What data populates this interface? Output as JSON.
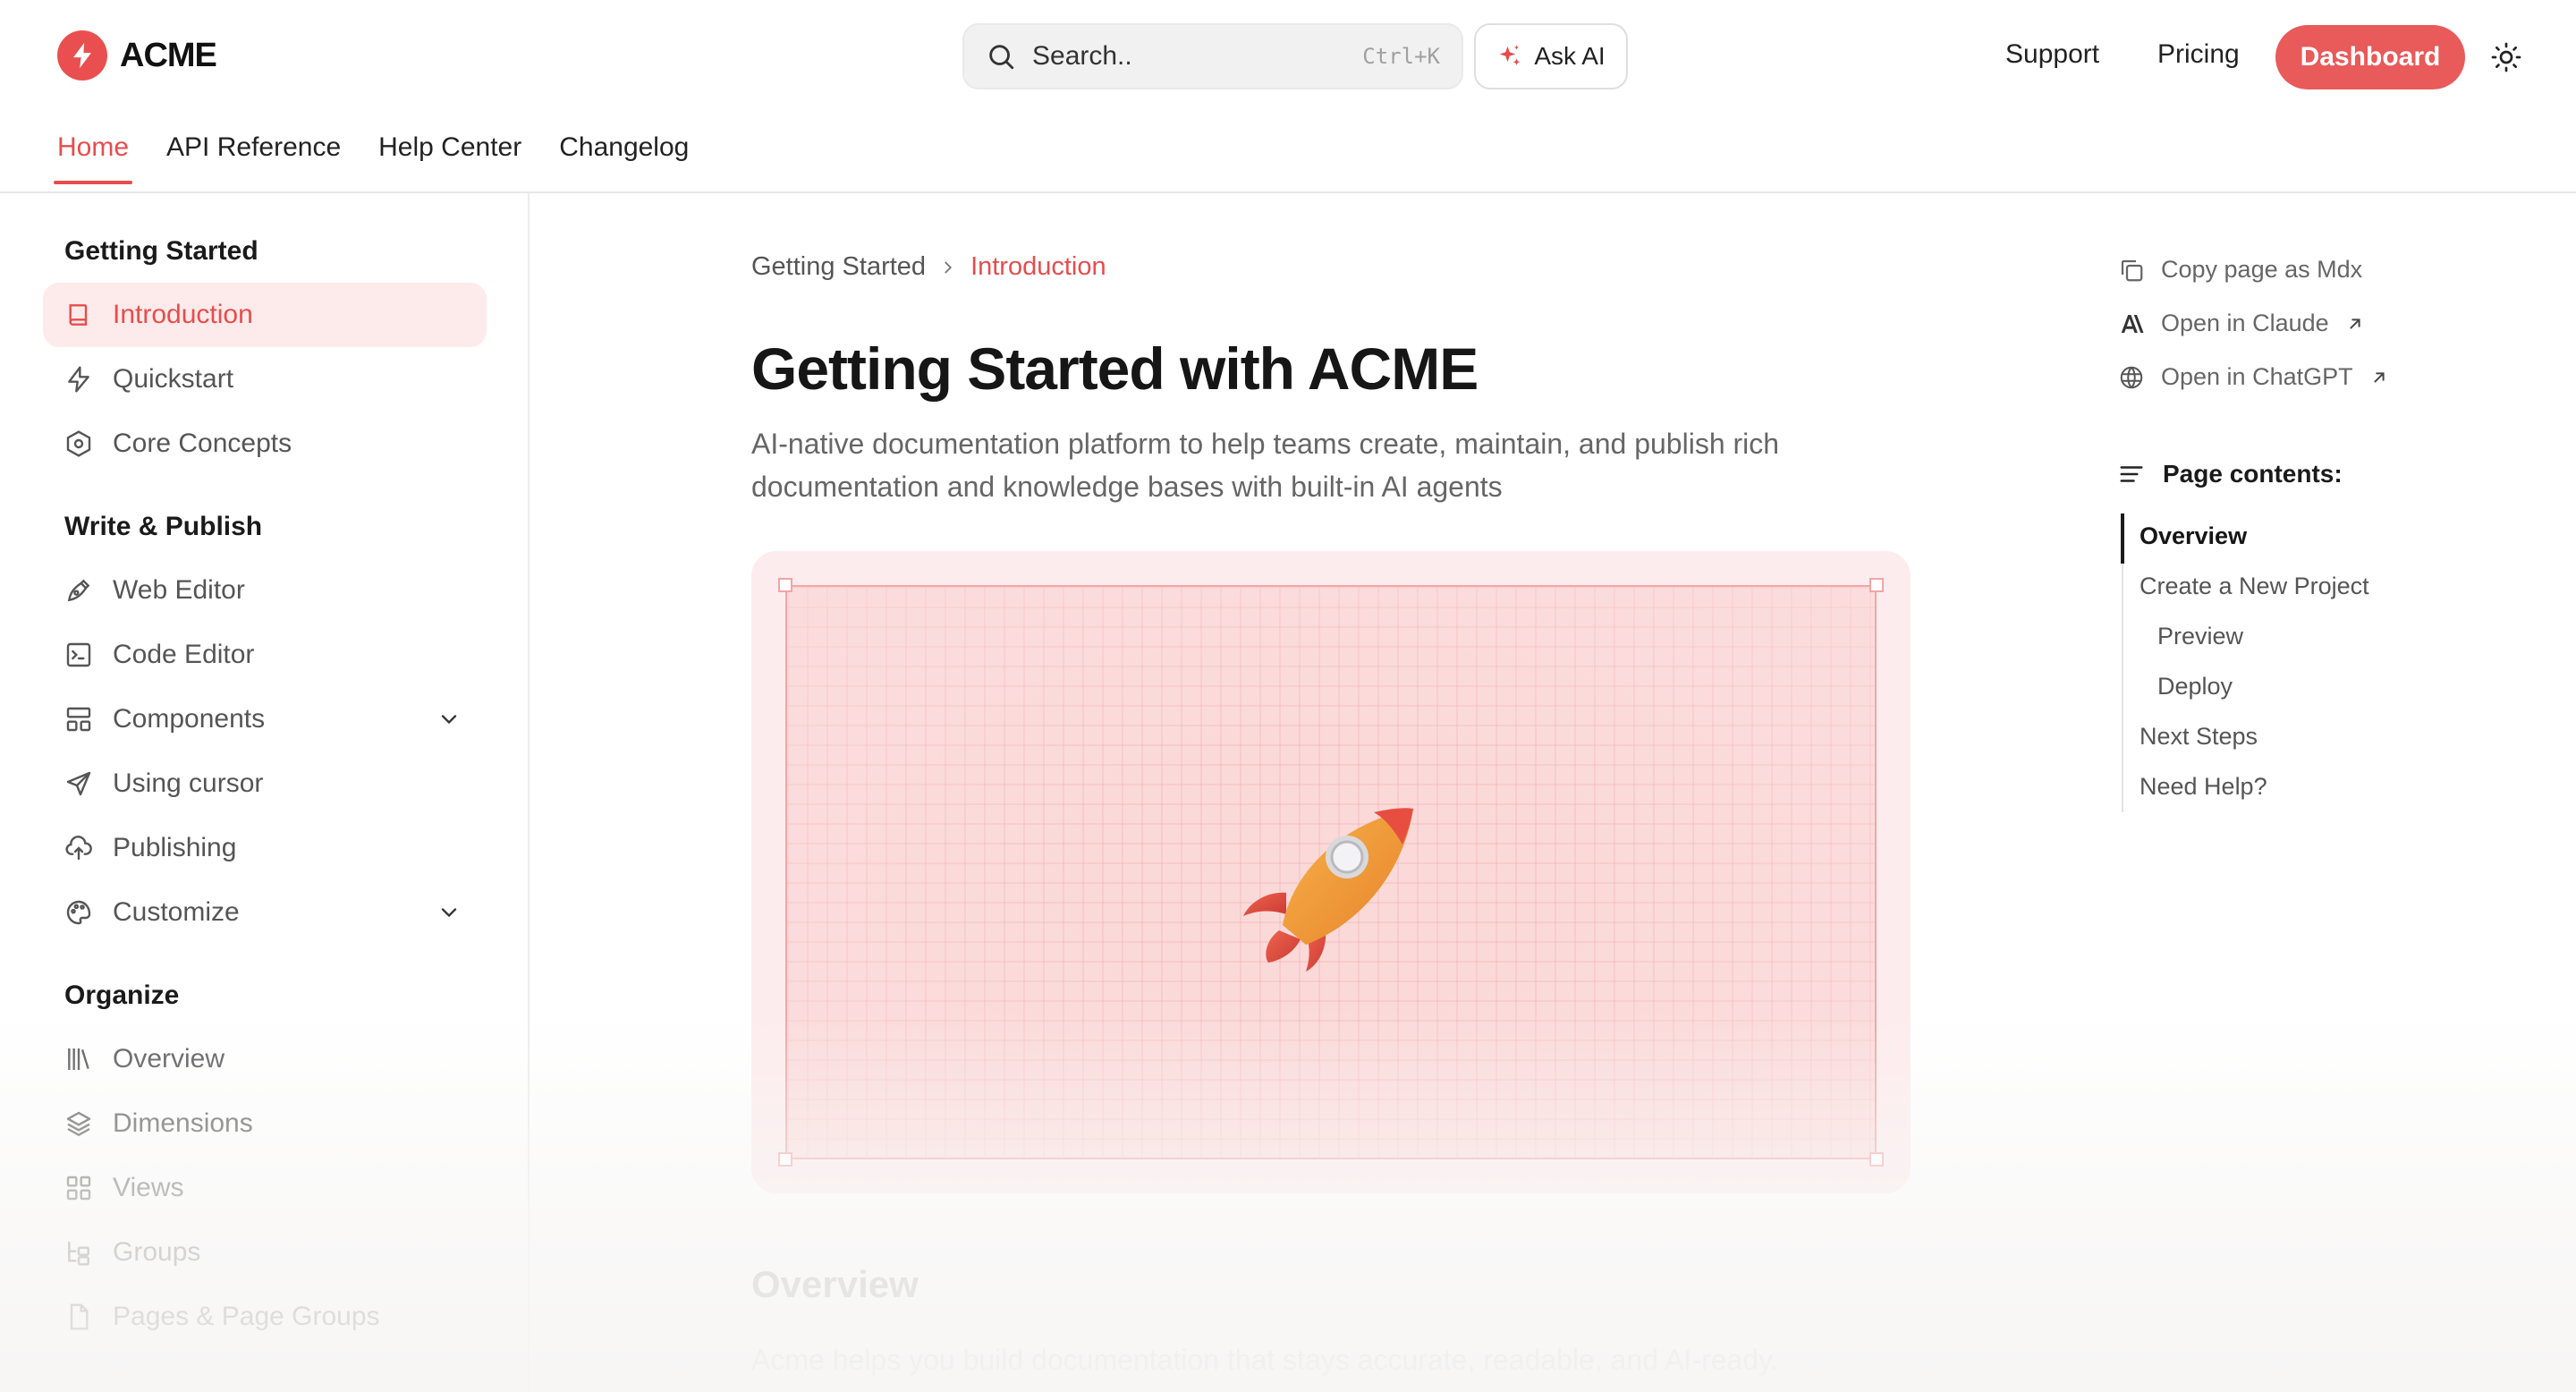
{
  "header": {
    "brand": "ACME",
    "search_placeholder": "Search..",
    "search_shortcut": "Ctrl+K",
    "ask_ai": "Ask AI",
    "support": "Support",
    "pricing": "Pricing",
    "dashboard": "Dashboard",
    "accent_color": "#e95a5a"
  },
  "tabs": [
    {
      "label": "Home",
      "active": true
    },
    {
      "label": "API Reference"
    },
    {
      "label": "Help Center"
    },
    {
      "label": "Changelog"
    }
  ],
  "sidebar": {
    "sections": [
      {
        "title": "Getting Started",
        "items": [
          {
            "label": "Introduction",
            "icon": "book-icon",
            "active": true
          },
          {
            "label": "Quickstart",
            "icon": "zap-icon"
          },
          {
            "label": "Core Concepts",
            "icon": "hexagon-icon"
          }
        ]
      },
      {
        "title": "Write & Publish",
        "items": [
          {
            "label": "Web Editor",
            "icon": "pen-icon"
          },
          {
            "label": "Code Editor",
            "icon": "terminal-icon"
          },
          {
            "label": "Components",
            "icon": "layout-icon",
            "expandable": true
          },
          {
            "label": "Using cursor",
            "icon": "send-icon"
          },
          {
            "label": "Publishing",
            "icon": "cloud-upload-icon"
          },
          {
            "label": "Customize",
            "icon": "palette-icon",
            "expandable": true
          }
        ]
      },
      {
        "title": "Organize",
        "items": [
          {
            "label": "Overview",
            "icon": "library-icon"
          },
          {
            "label": "Dimensions",
            "icon": "layers-icon"
          },
          {
            "label": "Views",
            "icon": "grid-icon"
          },
          {
            "label": "Groups",
            "icon": "tree-icon"
          },
          {
            "label": "Pages & Page Groups",
            "icon": "file-icon"
          }
        ]
      }
    ]
  },
  "main": {
    "breadcrumb": [
      "Getting Started",
      "Introduction"
    ],
    "title": "Getting Started with ACME",
    "subtitle": "AI-native documentation platform to help teams create, maintain, and publish rich documentation and knowledge bases with built-in AI agents",
    "section_heading": "Overview",
    "section_text": "Acme helps you build documentation that stays accurate, readable, and AI-ready."
  },
  "right_rail": {
    "actions": [
      {
        "label": "Copy page as Mdx",
        "icon": "copy-icon"
      },
      {
        "label": "Open in Claude",
        "icon": "anthropic-icon",
        "external": true
      },
      {
        "label": "Open in ChatGPT",
        "icon": "openai-icon",
        "external": true
      }
    ],
    "toc_title": "Page contents:",
    "toc": [
      {
        "label": "Overview",
        "active": true,
        "level": 1
      },
      {
        "label": "Create a New Project",
        "level": 1
      },
      {
        "label": "Preview",
        "level": 2
      },
      {
        "label": "Deploy",
        "level": 2
      },
      {
        "label": "Next Steps",
        "level": 1
      },
      {
        "label": "Need Help?",
        "level": 1
      }
    ]
  }
}
